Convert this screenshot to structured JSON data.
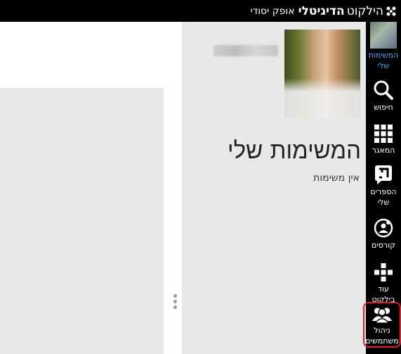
{
  "header": {
    "brand_hilkut": "הילקוט",
    "brand_digital": "הדיגיטלי",
    "mode": "אופק יסודי"
  },
  "sidebar": {
    "items": [
      {
        "label": "המשימות שלי",
        "icon": "avatar"
      },
      {
        "label": "חיפוש",
        "icon": "search-icon"
      },
      {
        "label": "המאגר",
        "icon": "grid-icon"
      },
      {
        "label": "הספרים שלי",
        "icon": "books-icon"
      },
      {
        "label": "קורסים",
        "icon": "courses-icon"
      },
      {
        "label": "עוד בילקוט",
        "icon": "plus-blocks-icon"
      },
      {
        "label": "ניהול משתמשים",
        "icon": "users-icon"
      }
    ],
    "active_color": "#4aa3ff",
    "highlight_color": "#e0202a"
  },
  "main": {
    "title": "המשימות שלי",
    "empty_message": "אין משימות"
  }
}
